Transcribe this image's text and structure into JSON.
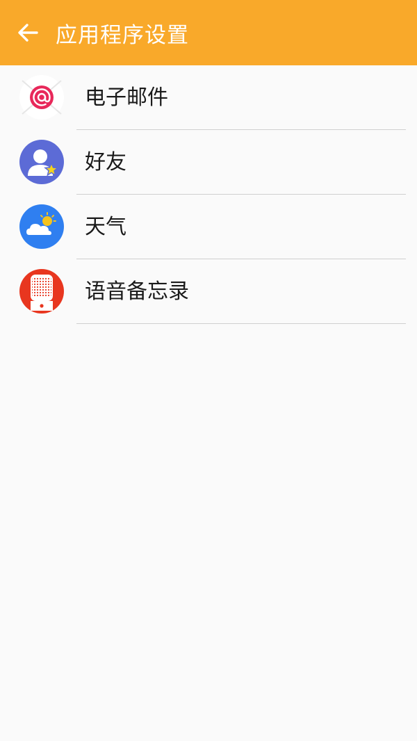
{
  "header": {
    "title": "应用程序设置",
    "background_color": "#f9a92a",
    "back_icon": "arrow-left-icon"
  },
  "apps": [
    {
      "label": "电子邮件",
      "icon": "email-icon",
      "icon_color": "#e8285a"
    },
    {
      "label": "好友",
      "icon": "friends-icon",
      "icon_color": "#5c6bd6"
    },
    {
      "label": "天气",
      "icon": "weather-icon",
      "icon_color": "#2f7ff0"
    },
    {
      "label": "语音备忘录",
      "icon": "voice-memo-icon",
      "icon_color": "#e8361f"
    }
  ]
}
